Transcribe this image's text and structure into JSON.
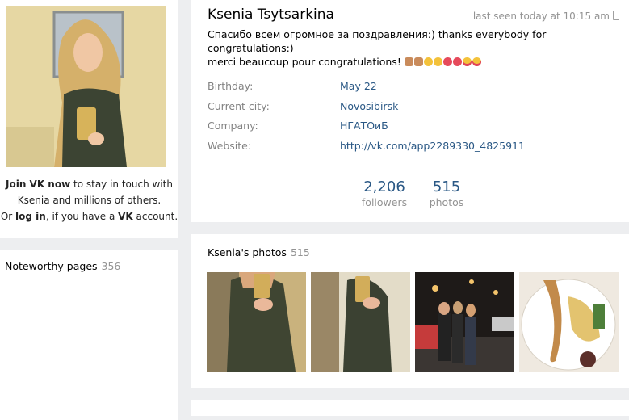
{
  "profile": {
    "name": "Ksenia Tsytsarkina",
    "last_seen": "last seen today at 10:15 am",
    "status_line1": "Спасибо всем огромное за поздравления:) thanks everybody for congratulations:)",
    "status_line2": "merci beaucoup pour congratulations!"
  },
  "join": {
    "join_link": "Join VK now",
    "join_rest": " to stay in touch with",
    "line2": "Ksenia and millions of others.",
    "or": "Or ",
    "login_link": "log in",
    "if_have": ", if you have a ",
    "vk": "VK",
    "account": " account."
  },
  "info": [
    {
      "label": "Birthday:",
      "value": "May 22"
    },
    {
      "label": "Current city:",
      "value": "Novosibirsk"
    },
    {
      "label": "Company:",
      "value": "НГАТОиБ"
    },
    {
      "label": "Website:",
      "value": "http://vk.com/app2289330_4825911"
    }
  ],
  "counters": {
    "followers_num": "2,206",
    "followers_label": "followers",
    "photos_num": "515",
    "photos_label": "photos"
  },
  "photos_block": {
    "title": "Ksenia's photos",
    "count": "515"
  },
  "noteworthy": {
    "title": "Noteworthy pages",
    "count": "356"
  },
  "colors": {
    "link": "#2a5885",
    "muted": "#939393",
    "label": "#828282",
    "page_bg": "#edeef0"
  }
}
